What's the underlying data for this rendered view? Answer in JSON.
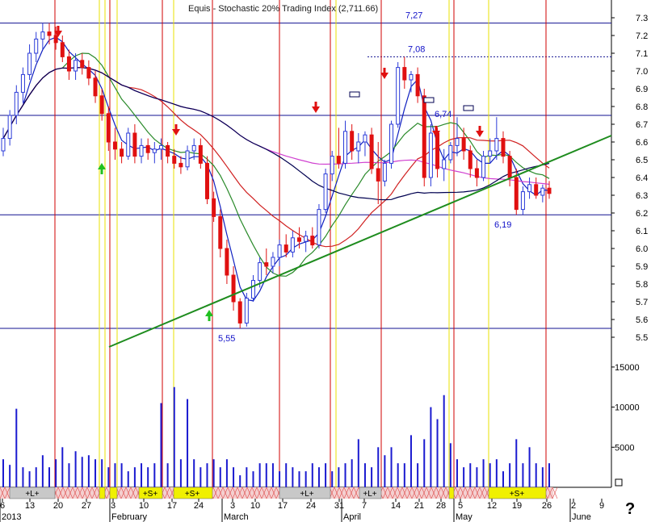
{
  "title": "Equis - Stochastic 20% Trading Index (2,711.66)",
  "help_glyph": "?",
  "colors": {
    "up_candle": "#2a3ad8",
    "down_candle": "#e01010",
    "volume": "#1a1ad0",
    "trendline": "#1e8c1e",
    "ma_blue": "#1020c0",
    "ma_green": "#2a8a2a",
    "ma_red": "#d02020",
    "ma_magenta": "#d040d0",
    "ma_black": "#000050",
    "vline_red": "#d00000",
    "vline_yellow": "#e8e000",
    "hline": "#101090"
  },
  "chart_data": {
    "type": "candlestick",
    "price_axis": {
      "min": 5.4,
      "max": 7.4,
      "ticks": [
        "7.3",
        "7.2",
        "7.1",
        "7.0",
        "6.9",
        "6.8",
        "6.7",
        "6.6",
        "6.5",
        "6.4",
        "6.3",
        "6.2",
        "6.1",
        "6.0",
        "5.9",
        "5.8",
        "5.7",
        "5.6",
        "5.5"
      ]
    },
    "volume_axis": {
      "max": 16500,
      "ticks": [
        "15000",
        "10000",
        "5000"
      ]
    },
    "x_tick_labels": [
      "6",
      "13",
      "20",
      "27",
      "3",
      "10",
      "17",
      "24",
      "3",
      "10",
      "17",
      "24",
      "31",
      "7",
      "14",
      "21",
      "28",
      "5",
      "12",
      "19",
      "26",
      "2",
      "9"
    ],
    "month_labels": [
      "2013",
      "February",
      "March",
      "April",
      "May",
      "June"
    ],
    "annotations": [
      "7,27",
      "7,08",
      "6,74",
      "6,19",
      "5,55"
    ],
    "band_labels": [
      "+L+",
      "+S+",
      "+S+",
      "+L+",
      "+L+",
      "+S+"
    ],
    "candles": [
      [
        6.55,
        6.68,
        6.52,
        6.62
      ],
      [
        6.62,
        6.78,
        6.58,
        6.75
      ],
      [
        6.75,
        6.92,
        6.7,
        6.88
      ],
      [
        6.88,
        7.02,
        6.82,
        6.98
      ],
      [
        6.98,
        7.15,
        6.95,
        7.1
      ],
      [
        7.1,
        7.22,
        7.05,
        7.18
      ],
      [
        7.18,
        7.27,
        7.12,
        7.22
      ],
      [
        7.22,
        7.27,
        7.15,
        7.2
      ],
      [
        7.2,
        7.25,
        7.12,
        7.16
      ],
      [
        7.16,
        7.2,
        7.05,
        7.08
      ],
      [
        7.08,
        7.12,
        6.95,
        7.0
      ],
      [
        7.0,
        7.1,
        6.95,
        7.06
      ],
      [
        7.06,
        7.1,
        6.98,
        7.02
      ],
      [
        7.02,
        7.06,
        6.92,
        6.96
      ],
      [
        6.96,
        7.0,
        6.82,
        6.86
      ],
      [
        6.86,
        6.9,
        6.72,
        6.76
      ],
      [
        6.76,
        6.8,
        6.55,
        6.6
      ],
      [
        6.6,
        6.68,
        6.5,
        6.56
      ],
      [
        6.56,
        6.6,
        6.48,
        6.52
      ],
      [
        6.52,
        6.68,
        6.5,
        6.65
      ],
      [
        6.65,
        6.7,
        6.48,
        6.52
      ],
      [
        6.52,
        6.62,
        6.48,
        6.58
      ],
      [
        6.58,
        6.62,
        6.5,
        6.54
      ],
      [
        6.54,
        6.6,
        6.48,
        6.56
      ],
      [
        6.56,
        6.62,
        6.5,
        6.58
      ],
      [
        6.58,
        6.6,
        6.48,
        6.52
      ],
      [
        6.52,
        6.56,
        6.45,
        6.48
      ],
      [
        6.48,
        6.52,
        6.42,
        6.46
      ],
      [
        6.46,
        6.58,
        6.44,
        6.55
      ],
      [
        6.55,
        6.62,
        6.5,
        6.58
      ],
      [
        6.58,
        6.62,
        6.45,
        6.48
      ],
      [
        6.48,
        6.52,
        6.25,
        6.28
      ],
      [
        6.28,
        6.32,
        6.15,
        6.18
      ],
      [
        6.18,
        6.22,
        5.95,
        6.0
      ],
      [
        6.0,
        6.05,
        5.8,
        5.85
      ],
      [
        5.85,
        5.9,
        5.65,
        5.7
      ],
      [
        5.7,
        5.72,
        5.55,
        5.58
      ],
      [
        5.58,
        5.75,
        5.56,
        5.72
      ],
      [
        5.72,
        5.85,
        5.7,
        5.82
      ],
      [
        5.82,
        5.95,
        5.78,
        5.92
      ],
      [
        5.92,
        6.0,
        5.85,
        5.9
      ],
      [
        5.9,
        5.98,
        5.86,
        5.95
      ],
      [
        5.95,
        6.05,
        5.9,
        6.02
      ],
      [
        6.02,
        6.08,
        5.95,
        5.98
      ],
      [
        5.98,
        6.1,
        5.95,
        6.06
      ],
      [
        6.06,
        6.12,
        6.0,
        6.04
      ],
      [
        6.04,
        6.1,
        5.98,
        6.07
      ],
      [
        6.07,
        6.12,
        6.0,
        6.02
      ],
      [
        6.02,
        6.25,
        6.0,
        6.22
      ],
      [
        6.22,
        6.45,
        6.2,
        6.42
      ],
      [
        6.42,
        6.55,
        6.38,
        6.52
      ],
      [
        6.52,
        6.68,
        6.45,
        6.48
      ],
      [
        6.48,
        6.72,
        6.45,
        6.66
      ],
      [
        6.66,
        6.7,
        6.5,
        6.55
      ],
      [
        6.55,
        6.65,
        6.48,
        6.6
      ],
      [
        6.6,
        6.66,
        6.52,
        6.64
      ],
      [
        6.64,
        6.68,
        6.42,
        6.45
      ],
      [
        6.45,
        6.6,
        6.25,
        6.38
      ],
      [
        6.38,
        6.5,
        6.35,
        6.48
      ],
      [
        6.48,
        6.72,
        6.45,
        6.7
      ],
      [
        6.7,
        7.05,
        6.68,
        7.02
      ],
      [
        7.02,
        7.08,
        6.9,
        6.95
      ],
      [
        6.95,
        7.0,
        6.88,
        6.98
      ],
      [
        6.98,
        7.02,
        6.82,
        6.86
      ],
      [
        6.86,
        6.9,
        6.35,
        6.4
      ],
      [
        6.4,
        6.7,
        6.35,
        6.65
      ],
      [
        6.65,
        6.68,
        6.4,
        6.45
      ],
      [
        6.45,
        6.56,
        6.38,
        6.5
      ],
      [
        6.5,
        6.6,
        6.48,
        6.58
      ],
      [
        6.58,
        6.74,
        6.52,
        6.62
      ],
      [
        6.62,
        6.68,
        6.5,
        6.55
      ],
      [
        6.55,
        6.58,
        6.4,
        6.45
      ],
      [
        6.45,
        6.5,
        6.35,
        6.4
      ],
      [
        6.4,
        6.55,
        6.38,
        6.52
      ],
      [
        6.52,
        6.62,
        6.48,
        6.55
      ],
      [
        6.55,
        6.74,
        6.5,
        6.62
      ],
      [
        6.62,
        6.66,
        6.48,
        6.52
      ],
      [
        6.52,
        6.55,
        6.35,
        6.4
      ],
      [
        6.4,
        6.45,
        6.19,
        6.22
      ],
      [
        6.22,
        6.35,
        6.19,
        6.32
      ],
      [
        6.32,
        6.4,
        6.28,
        6.36
      ],
      [
        6.36,
        6.4,
        6.28,
        6.3
      ],
      [
        6.3,
        6.36,
        6.26,
        6.34
      ],
      [
        6.34,
        6.38,
        6.28,
        6.31
      ]
    ],
    "volumes": [
      3500,
      2800,
      9800,
      2500,
      2000,
      2500,
      4000,
      2500,
      3500,
      5000,
      3000,
      4500,
      3800,
      4000,
      3500,
      3500,
      2500,
      3000,
      3000,
      2000,
      2500,
      3000,
      2500,
      3000,
      10500,
      3000,
      12500,
      3500,
      11000,
      3500,
      2500,
      3000,
      3500,
      2500,
      3500,
      2500,
      1500,
      2500,
      2000,
      3000,
      3000,
      3000,
      2000,
      3000,
      2500,
      2000,
      2000,
      3000,
      2500,
      3000,
      2000,
      2500,
      3000,
      3500,
      6000,
      3000,
      2500,
      5000,
      4000,
      5000,
      3000,
      3000,
      6500,
      3000,
      6000,
      10000,
      8500,
      11500,
      5500,
      3500,
      2500,
      3000,
      2500,
      3500,
      3000,
      3500,
      2000,
      3000,
      6000,
      3000,
      5000,
      3000,
      2500,
      3000
    ]
  }
}
